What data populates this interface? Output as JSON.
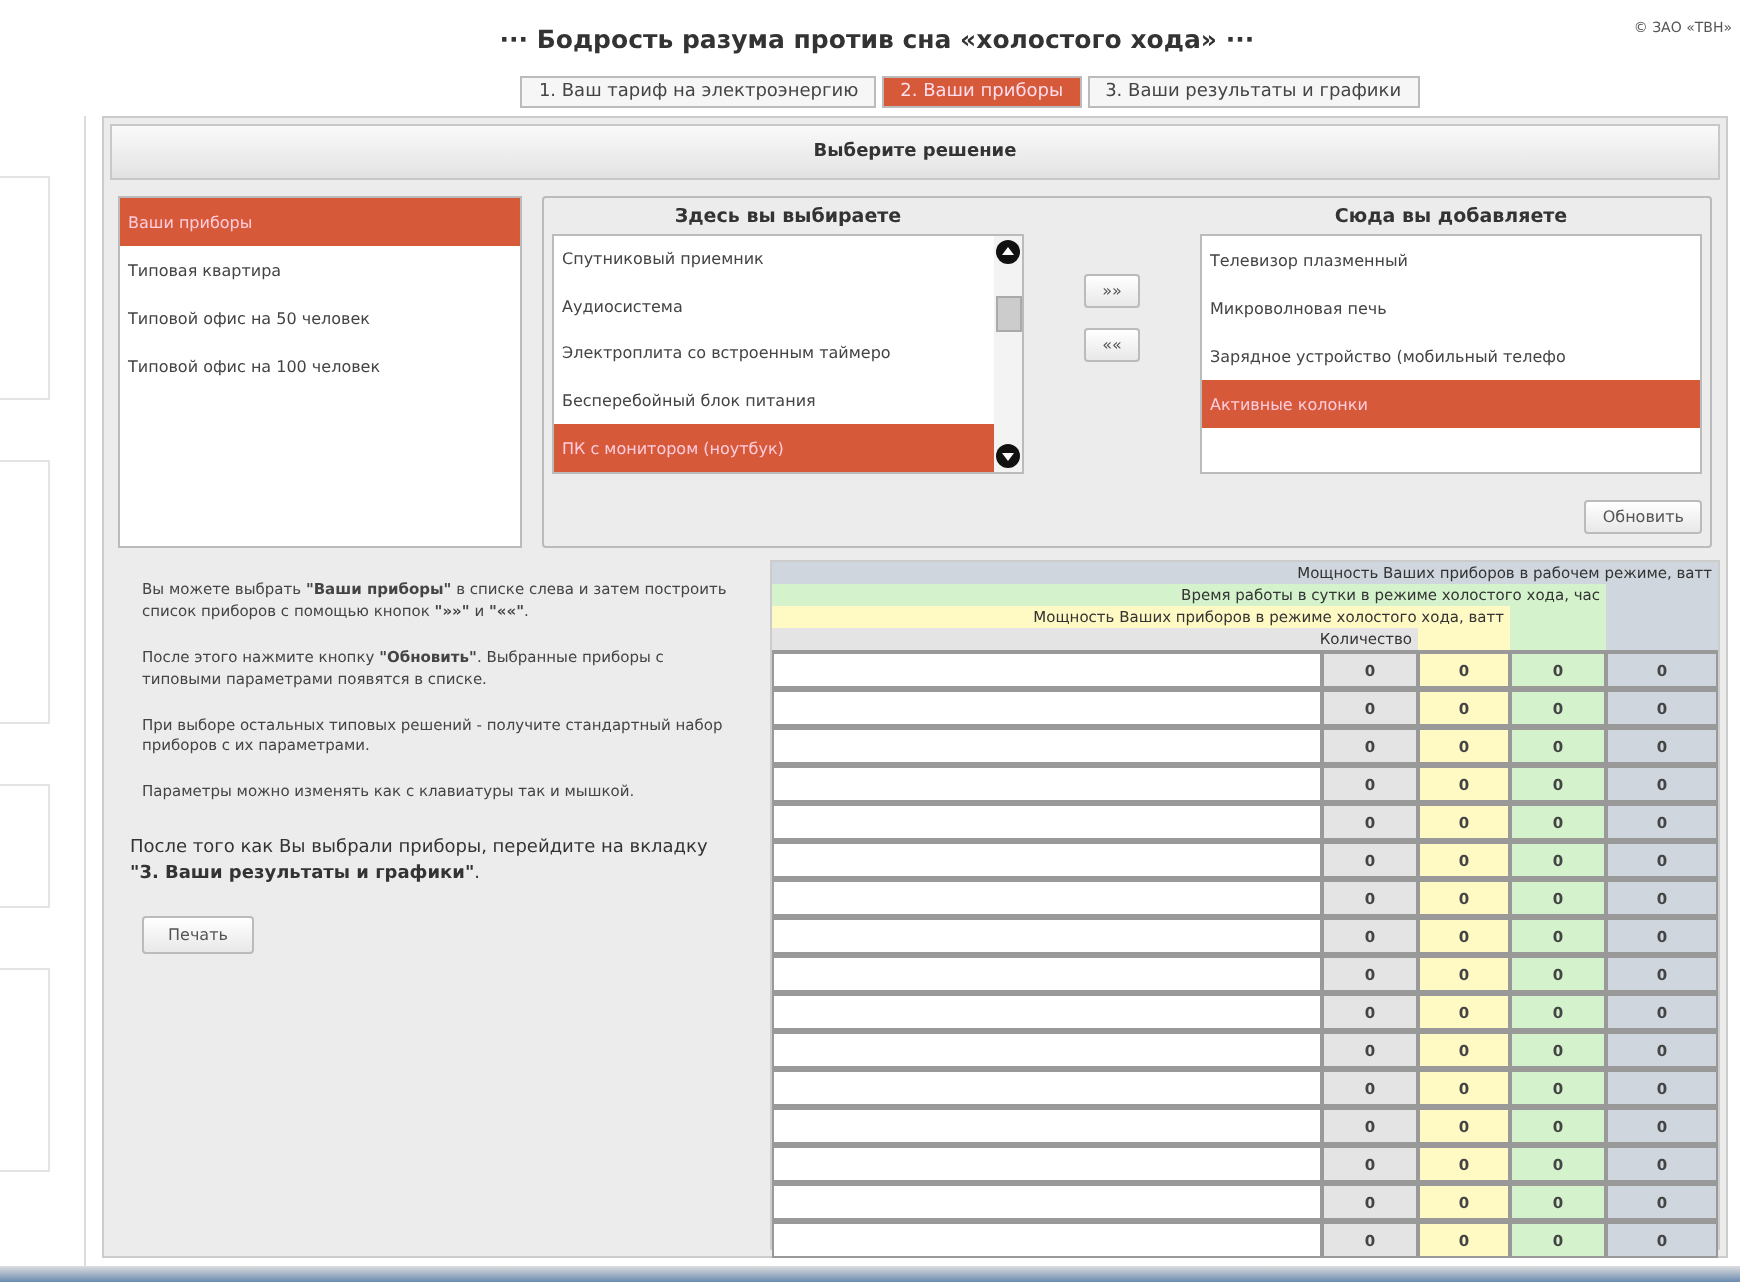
{
  "title": "··· Бодрость разума против сна «холостого хода» ···",
  "copyright": "© ЗАО «ТВН»",
  "tabs": [
    {
      "label": "1. Ваш тариф на электроэнергию",
      "selected": false
    },
    {
      "label": "2. Ваши приборы",
      "selected": true
    },
    {
      "label": "3. Ваши результаты и графики",
      "selected": false
    }
  ],
  "panel_title": "Выберите решение",
  "solutions": [
    {
      "label": "Ваши приборы",
      "selected": true
    },
    {
      "label": "Типовая квартира",
      "selected": false
    },
    {
      "label": "Типовой офис на 50 человек",
      "selected": false
    },
    {
      "label": "Типовой офис на 100 человек",
      "selected": false
    }
  ],
  "available": {
    "title": "Здесь вы выбираете",
    "items": [
      {
        "label": "Спутниковый приемник",
        "selected": false
      },
      {
        "label": "Аудиосистема",
        "selected": false
      },
      {
        "label": "Электроплита со встроенным таймеро",
        "selected": false
      },
      {
        "label": "Бесперебойный блок питания",
        "selected": false
      },
      {
        "label": "ПК с монитором (ноутбук)",
        "selected": true
      }
    ]
  },
  "move_buttons": [
    "»»",
    "««"
  ],
  "added": {
    "title": "Сюда вы добавляете",
    "items": [
      {
        "label": "Телевизор плазменный",
        "selected": false
      },
      {
        "label": "Микроволновая печь",
        "selected": false
      },
      {
        "label": "Зарядное устройство (мобильный телефо",
        "selected": false
      },
      {
        "label": "Активные колонки",
        "selected": true
      }
    ]
  },
  "refresh_button": "Обновить",
  "instructions": [
    "Вы можете выбрать **\"Ваши приборы\"** в списке слева и затем построить список приборов с помощью кнопок **\"»»\"** и **\"««\"**.",
    "После этого нажмите кнопку **\"Обновить\"**. Выбранные приборы с типовыми параметрами появятся в списке.",
    "При выборе остальных типовых решений - получите стандартный набор приборов с их параметрами.",
    "Параметры можно изменять как с клавиатуры так и мышкой."
  ],
  "final_note": "После того как Вы выбрали приборы, перейдите на вкладку **\"3. Ваши результаты и графики\"**.",
  "print_button": "Печать",
  "table": {
    "headers": [
      "Мощность Ваших приборов в рабочем режиме, ватт",
      "Время работы в сутки в режиме холостого хода, час",
      "Мощность Ваших приборов в режиме холостого хода, ватт",
      "Количество"
    ],
    "rows": [
      {
        "quantity": "0",
        "idle_power": "0",
        "idle_hours": "0",
        "work_power": "0"
      },
      {
        "quantity": "0",
        "idle_power": "0",
        "idle_hours": "0",
        "work_power": "0"
      },
      {
        "quantity": "0",
        "idle_power": "0",
        "idle_hours": "0",
        "work_power": "0"
      },
      {
        "quantity": "0",
        "idle_power": "0",
        "idle_hours": "0",
        "work_power": "0"
      },
      {
        "quantity": "0",
        "idle_power": "0",
        "idle_hours": "0",
        "work_power": "0"
      },
      {
        "quantity": "0",
        "idle_power": "0",
        "idle_hours": "0",
        "work_power": "0"
      },
      {
        "quantity": "0",
        "idle_power": "0",
        "idle_hours": "0",
        "work_power": "0"
      },
      {
        "quantity": "0",
        "idle_power": "0",
        "idle_hours": "0",
        "work_power": "0"
      },
      {
        "quantity": "0",
        "idle_power": "0",
        "idle_hours": "0",
        "work_power": "0"
      },
      {
        "quantity": "0",
        "idle_power": "0",
        "idle_hours": "0",
        "work_power": "0"
      },
      {
        "quantity": "0",
        "idle_power": "0",
        "idle_hours": "0",
        "work_power": "0"
      },
      {
        "quantity": "0",
        "idle_power": "0",
        "idle_hours": "0",
        "work_power": "0"
      },
      {
        "quantity": "0",
        "idle_power": "0",
        "idle_hours": "0",
        "work_power": "0"
      },
      {
        "quantity": "0",
        "idle_power": "0",
        "idle_hours": "0",
        "work_power": "0"
      },
      {
        "quantity": "0",
        "idle_power": "0",
        "idle_hours": "0",
        "work_power": "0"
      },
      {
        "quantity": "0",
        "idle_power": "0",
        "idle_hours": "0",
        "work_power": "0"
      }
    ]
  }
}
